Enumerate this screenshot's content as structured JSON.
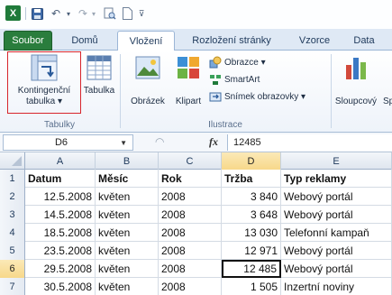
{
  "qat": {
    "icons": [
      "excel-icon",
      "save-icon",
      "undo-icon",
      "redo-icon",
      "print-preview-icon",
      "new-document-icon",
      "customize-icon"
    ]
  },
  "tabs": [
    {
      "label": "Soubor"
    },
    {
      "label": "Domů"
    },
    {
      "label": "Vložení"
    },
    {
      "label": "Rozložení stránky"
    },
    {
      "label": "Vzorce"
    },
    {
      "label": "Data"
    }
  ],
  "ribbon": {
    "tables_group": {
      "label": "Tabulky",
      "pivot_line1": "Kontingenční",
      "pivot_line2": "tabulka ▾",
      "table_label": "Tabulka"
    },
    "illustrations_group": {
      "label": "Ilustrace",
      "picture_label": "Obrázek",
      "clipart_label": "Klipart",
      "shapes_label": "Obrazce ▾",
      "smartart_label": "SmartArt",
      "screenshot_label": "Snímek obrazovky ▾"
    },
    "charts_group": {
      "column_label": "Sloupcový",
      "next_label": "Sp"
    }
  },
  "formula_bar": {
    "name_box": "D6",
    "fx": "fx",
    "value": "12485"
  },
  "grid": {
    "columns": [
      "A",
      "B",
      "C",
      "D",
      "E"
    ],
    "selected_column": "D",
    "rows": [
      {
        "num": "1",
        "cells": [
          "Datum",
          "Měsíc",
          "Rok",
          "Tržba",
          "Typ reklamy"
        ],
        "header": true
      },
      {
        "num": "2",
        "cells": [
          "12.5.2008",
          "květen",
          "2008",
          "3 840",
          "Webový portál"
        ]
      },
      {
        "num": "3",
        "cells": [
          "14.5.2008",
          "květen",
          "2008",
          "3 648",
          "Webový portál"
        ]
      },
      {
        "num": "4",
        "cells": [
          "18.5.2008",
          "květen",
          "2008",
          "13 030",
          "Telefonní kampaň"
        ]
      },
      {
        "num": "5",
        "cells": [
          "23.5.2008",
          "květen",
          "2008",
          "12 971",
          "Webový portál"
        ]
      },
      {
        "num": "6",
        "cells": [
          "29.5.2008",
          "květen",
          "2008",
          "12 485",
          "Webový portál"
        ],
        "selected": true
      },
      {
        "num": "7",
        "cells": [
          "30.5.2008",
          "květen",
          "2008",
          "1 505",
          "Inzertní noviny"
        ]
      }
    ]
  }
}
